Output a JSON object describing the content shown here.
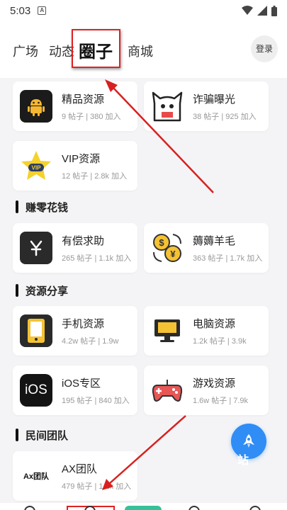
{
  "status_bar": {
    "time": "5:03",
    "notif_letter": "A",
    "icons": [
      "wifi-icon",
      "signal-icon",
      "battery-icon"
    ]
  },
  "nav": {
    "tabs": [
      {
        "label": "广场",
        "active": false
      },
      {
        "label": "动态",
        "active": false
      },
      {
        "label": "圈子",
        "active": true
      },
      {
        "label": "商城",
        "active": false
      }
    ],
    "login_label": "登录"
  },
  "featured": [
    {
      "title": "精品资源",
      "meta": "9 帖子 | 380 加入",
      "icon": "android-icon"
    },
    {
      "title": "诈骗曝光",
      "meta": "38 帖子 | 925 加入",
      "icon": "ghost-icon"
    },
    {
      "title": "VIP资源",
      "meta": "12 帖子 | 2.8k 加入",
      "icon": "vip-star-icon"
    }
  ],
  "sections": [
    {
      "title": "赚零花钱",
      "items": [
        {
          "title": "有偿求助",
          "meta": "265 帖子 | 1.1k 加入",
          "icon": "yen-icon"
        },
        {
          "title": "薅薅羊毛",
          "meta": "363 帖子 | 1.7k 加入",
          "icon": "coin-exchange-icon"
        }
      ]
    },
    {
      "title": "资源分享",
      "items": [
        {
          "title": "手机资源",
          "meta": "4.2w 帖子 | 1.9w",
          "icon": "phone-icon"
        },
        {
          "title": "电脑资源",
          "meta": "1.2k 帖子 | 3.9k",
          "icon": "monitor-icon"
        },
        {
          "title": "iOS专区",
          "meta": "195 帖子 | 840 加入",
          "icon": "ios-icon",
          "icon_text": "iOS"
        },
        {
          "title": "游戏资源",
          "meta": "1.6w 帖子 | 7.9k",
          "icon": "gamepad-icon"
        }
      ]
    },
    {
      "title": "民间团队",
      "items": [
        {
          "title": "AX团队",
          "meta": "479 帖子 | 1.1k 加入",
          "icon": "ax-logo-icon",
          "icon_text": "Ax团队"
        }
      ]
    }
  ],
  "fab": {
    "icon": "rocket-icon",
    "overlay_text": "站"
  },
  "colors": {
    "accent": "#2f8df5",
    "highlight": "#dd2222",
    "pill": "#35c29a"
  }
}
